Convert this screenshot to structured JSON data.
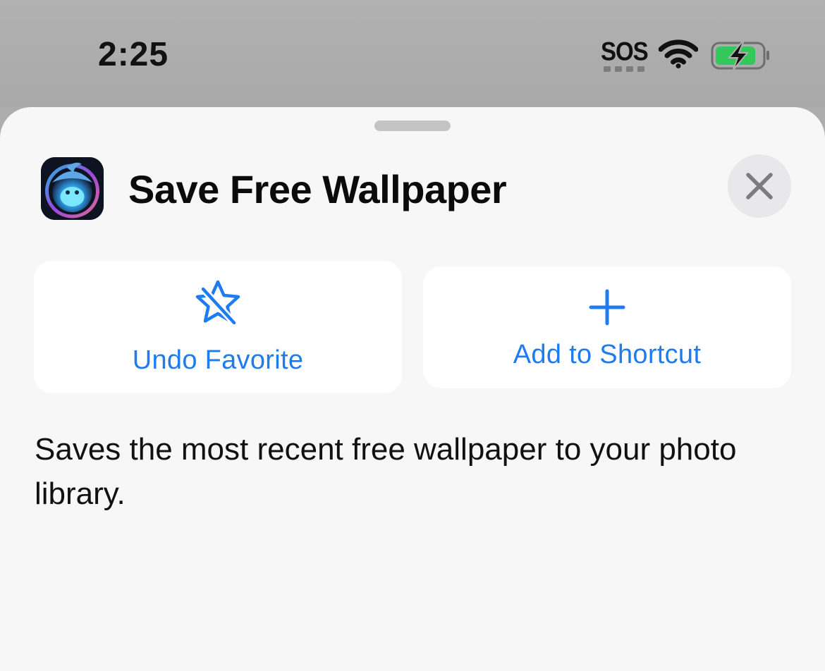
{
  "status_bar": {
    "time": "2:25",
    "sos_label": "SOS",
    "wifi_icon": "wifi-icon",
    "battery_icon": "battery-charging-icon",
    "battery_color": "#34c759"
  },
  "sheet": {
    "title": "Save Free Wallpaper",
    "app_icon": "app-icon",
    "close_icon": "close-icon",
    "actions": [
      {
        "label": "Undo Favorite",
        "icon": "star-slash-icon"
      },
      {
        "label": "Add to Shortcut",
        "icon": "plus-icon"
      }
    ],
    "description": "Saves the most recent free wallpaper to your photo library.",
    "accent_color": "#1e7cf0"
  }
}
